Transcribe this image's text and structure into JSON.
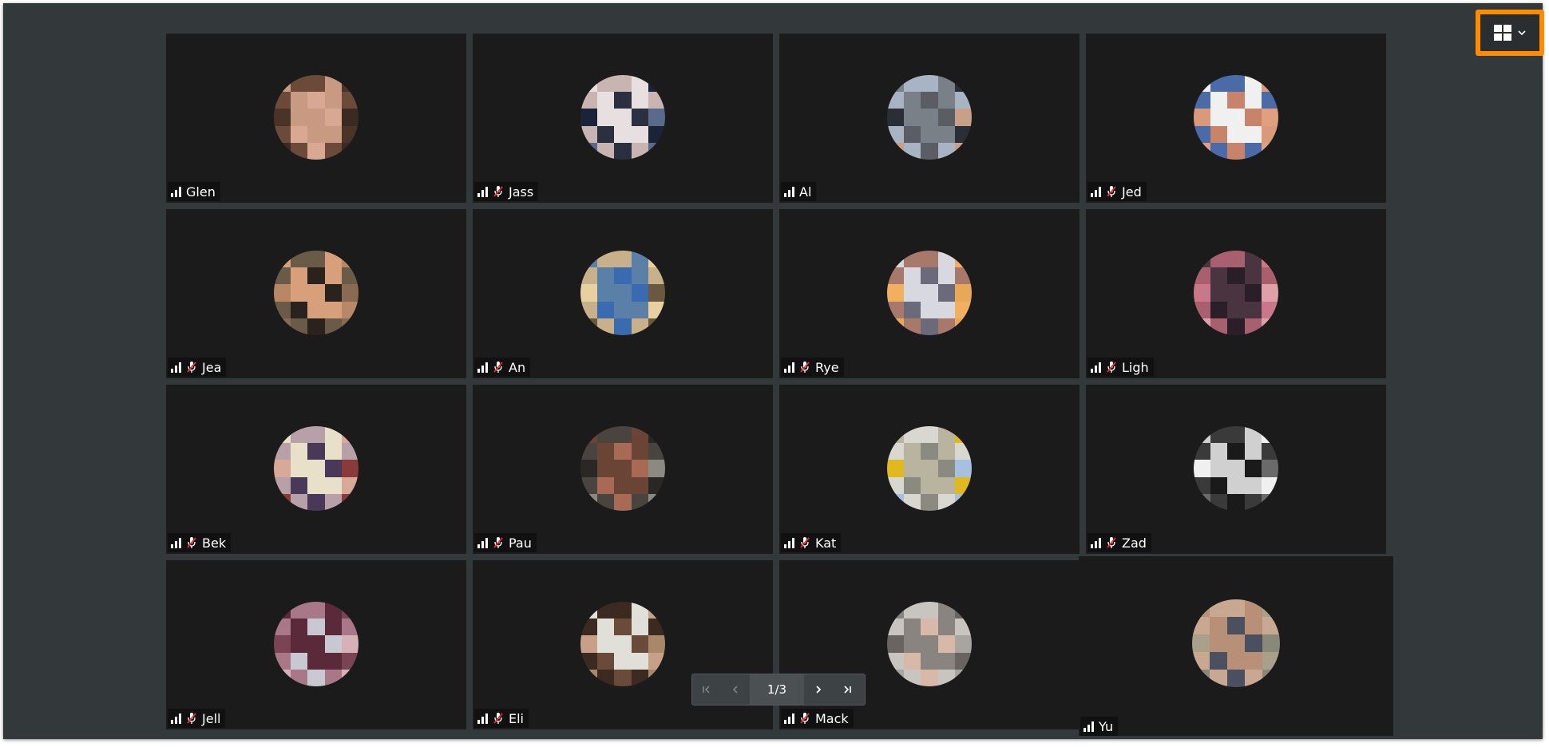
{
  "participants": [
    {
      "name": "Glen",
      "muted": false,
      "pal": [
        "#3a2a22",
        "#6b4a3a",
        "#c89a82",
        "#d8a892",
        "#4a3428"
      ]
    },
    {
      "name": "Jass",
      "muted": true,
      "pal": [
        "#1a2438",
        "#5a6a8a",
        "#c8b4b0",
        "#e8e0e0",
        "#2a3040"
      ]
    },
    {
      "name": "Al",
      "muted": false,
      "pal": [
        "#5a5e64",
        "#2a2e36",
        "#c8a08a",
        "#a8b4c4",
        "#7a8088"
      ]
    },
    {
      "name": "Jed",
      "muted": true,
      "pal": [
        "#f0f0f0",
        "#c8846a",
        "#d89a7a",
        "#e0a080",
        "#4a6aa8"
      ]
    },
    {
      "name": "Jea",
      "muted": true,
      "pal": [
        "#6a5a48",
        "#d8a07a",
        "#2a221c",
        "#b88866",
        "#8a6a52"
      ]
    },
    {
      "name": "An",
      "muted": true,
      "pal": [
        "#6a5840",
        "#c8b08a",
        "#5a80a8",
        "#3a6ab0",
        "#e8d0a0"
      ]
    },
    {
      "name": "Rye",
      "muted": true,
      "pal": [
        "#f0b060",
        "#e8a858",
        "#a8786a",
        "#d8d8e0",
        "#6a6a7a"
      ]
    },
    {
      "name": "Ligh",
      "muted": true,
      "pal": [
        "#2a1e28",
        "#c87888",
        "#e0a0a8",
        "#a8606e",
        "#4a3440"
      ]
    },
    {
      "name": "Bek",
      "muted": true,
      "pal": [
        "#e8e0c8",
        "#4a3858",
        "#d8a898",
        "#8a3a3a",
        "#b8a0a8"
      ]
    },
    {
      "name": "Pau",
      "muted": true,
      "pal": [
        "#4a4440",
        "#6a4434",
        "#a86a54",
        "#2a2826",
        "#8a8a82"
      ]
    },
    {
      "name": "Kat",
      "muted": true,
      "pal": [
        "#a8c0e0",
        "#d8d8d0",
        "#b8b4a0",
        "#8a8a80",
        "#e0b820"
      ]
    },
    {
      "name": "Zad",
      "muted": true,
      "pal": [
        "#f0f0f0",
        "#6a6a6a",
        "#3a3a3a",
        "#d0d0d0",
        "#1a1a1a"
      ]
    },
    {
      "name": "Jell",
      "muted": true,
      "pal": [
        "#c8c8d0",
        "#7a4454",
        "#d8b0b8",
        "#a87888",
        "#5a2a3a"
      ]
    },
    {
      "name": "Eli",
      "muted": true,
      "pal": [
        "#e0e0d8",
        "#6a4a38",
        "#c8a088",
        "#a88868",
        "#3a2a20"
      ]
    },
    {
      "name": "Mack",
      "muted": true,
      "pal": [
        "#c8c4c0",
        "#8a8480",
        "#d8b8a8",
        "#6a6460",
        "#a8a4a0"
      ]
    },
    {
      "name": "Yu",
      "muted": false,
      "pal": [
        "#8a8878",
        "#c8a890",
        "#b89078",
        "#4a5060",
        "#a8a08a"
      ]
    }
  ],
  "pagination": {
    "current": "1/3",
    "first_icon": "first-page-icon",
    "prev_icon": "prev-page-icon",
    "next_icon": "next-page-icon",
    "last_icon": "last-page-icon"
  },
  "layout_button": {
    "icon": "grid-layout-icon",
    "caret_icon": "chevron-down-icon",
    "highlight": "#ff8c00"
  },
  "colors": {
    "background": "#33383a",
    "tile": "#1b1b1b"
  }
}
